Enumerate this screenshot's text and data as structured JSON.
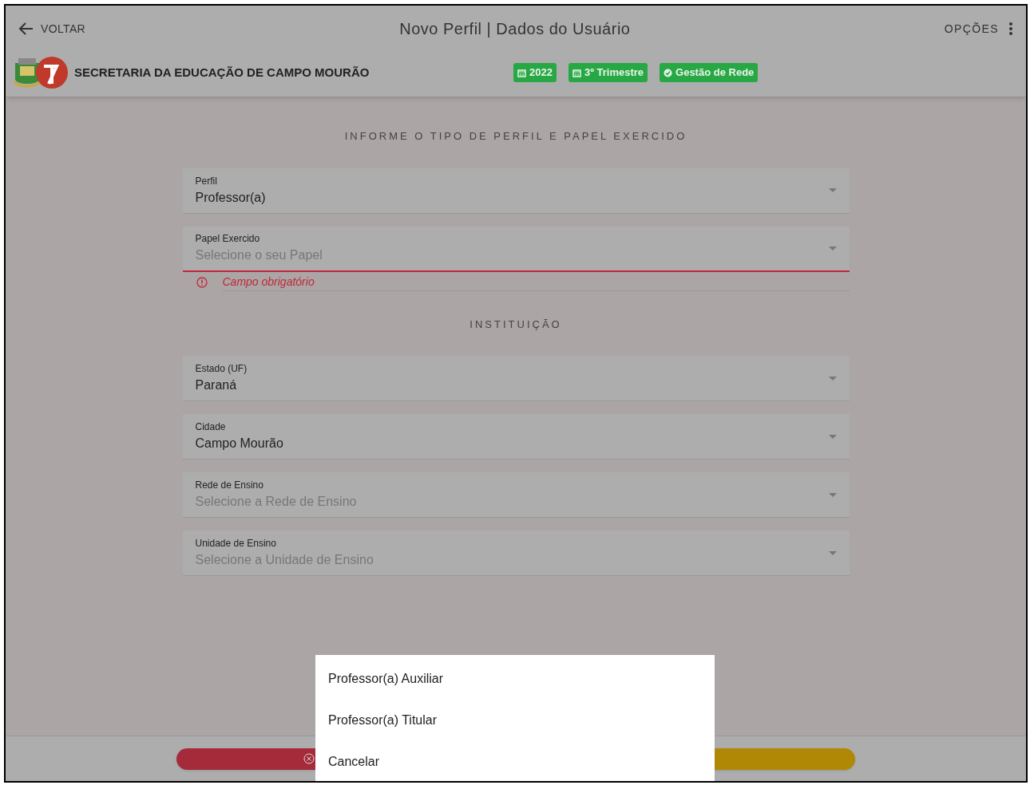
{
  "header": {
    "back": "VOLTAR",
    "title": "Novo Perfil | Dados do Usuário",
    "options": "OPÇÕES",
    "org": "SECRETARIA DA EDUCAÇÃO DE CAMPO MOURÃO",
    "badges": [
      {
        "kind": "calendar",
        "label": "2022"
      },
      {
        "kind": "calendar",
        "label": "3º Trimestre"
      },
      {
        "kind": "check",
        "label": "Gestão de Rede"
      }
    ]
  },
  "sections": [
    {
      "title": "INFORME O TIPO DE PERFIL E PAPEL EXERCIDO",
      "fields": [
        {
          "label": "Perfil",
          "value": "Professor(a)"
        },
        {
          "label": "Papel Exercido",
          "placeholder": "Selecione o seu Papel",
          "error": "Campo obrigatório"
        }
      ]
    },
    {
      "title": "INSTITUIÇÃO",
      "fields": [
        {
          "label": "Estado (UF)",
          "value": "Paraná"
        },
        {
          "label": "Cidade",
          "value": "Campo Mourão"
        },
        {
          "label": "Rede de Ensino",
          "placeholder": "Selecione a Rede de Ensino"
        },
        {
          "label": "Unidade de Ensino",
          "placeholder": "Selecione a Unidade de Ensino"
        }
      ]
    }
  ],
  "footer_buttons": [
    {
      "kind": "cancel"
    },
    {
      "kind": "warning"
    }
  ],
  "menu": {
    "items": [
      "Professor(a) Auxiliar",
      "Professor(a) Titular",
      "Cancelar"
    ]
  }
}
